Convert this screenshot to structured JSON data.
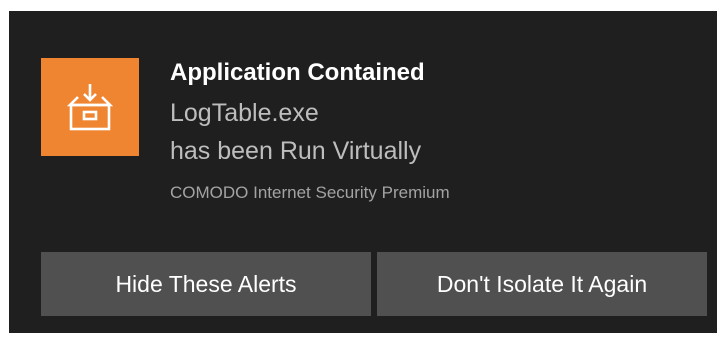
{
  "notification": {
    "icon": "container-download-icon",
    "accent_color": "#ef8431",
    "title": "Application Contained",
    "file_name": "LogTable.exe",
    "message": "has been Run Virtually",
    "source": "COMODO Internet Security Premium"
  },
  "actions": {
    "hide_label": "Hide These Alerts",
    "dont_isolate_label": "Don't Isolate It Again"
  }
}
